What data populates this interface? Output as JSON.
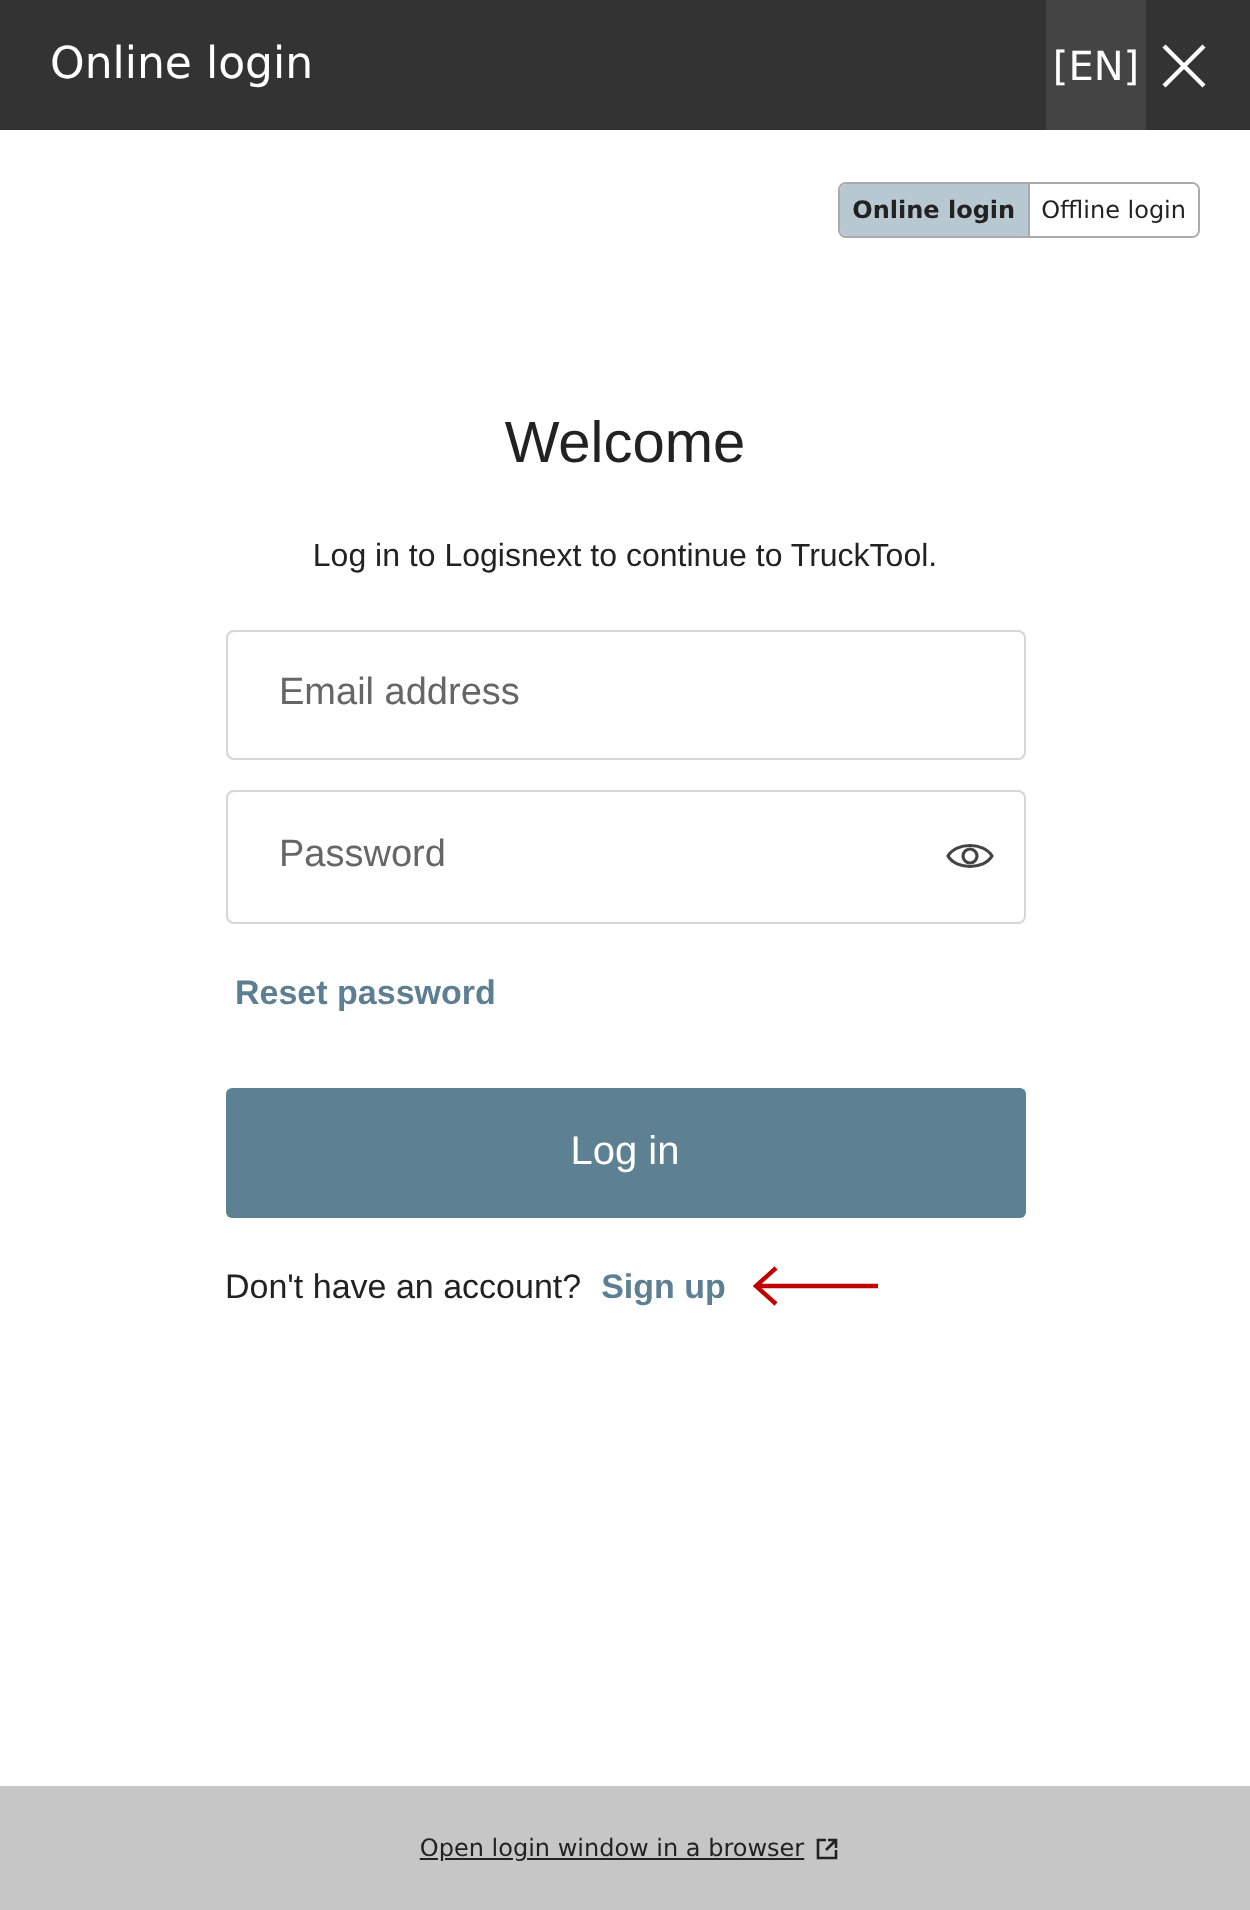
{
  "window": {
    "title": "Online login",
    "language": "[EN]"
  },
  "mode_toggle": [
    {
      "label": "Online login",
      "selected": true
    },
    {
      "label": "Offline login",
      "selected": false
    }
  ],
  "heading": "Welcome",
  "subtitle": "Log in to Logisnext to continue to TruckTool.",
  "email": {
    "placeholder": "Email address"
  },
  "password": {
    "placeholder": "Password"
  },
  "reset_link": "Reset password",
  "login_button": "Log in",
  "signup": {
    "prompt": "Don't have an account?",
    "link": "Sign up"
  },
  "footer_link": "Open login window in a browser"
}
